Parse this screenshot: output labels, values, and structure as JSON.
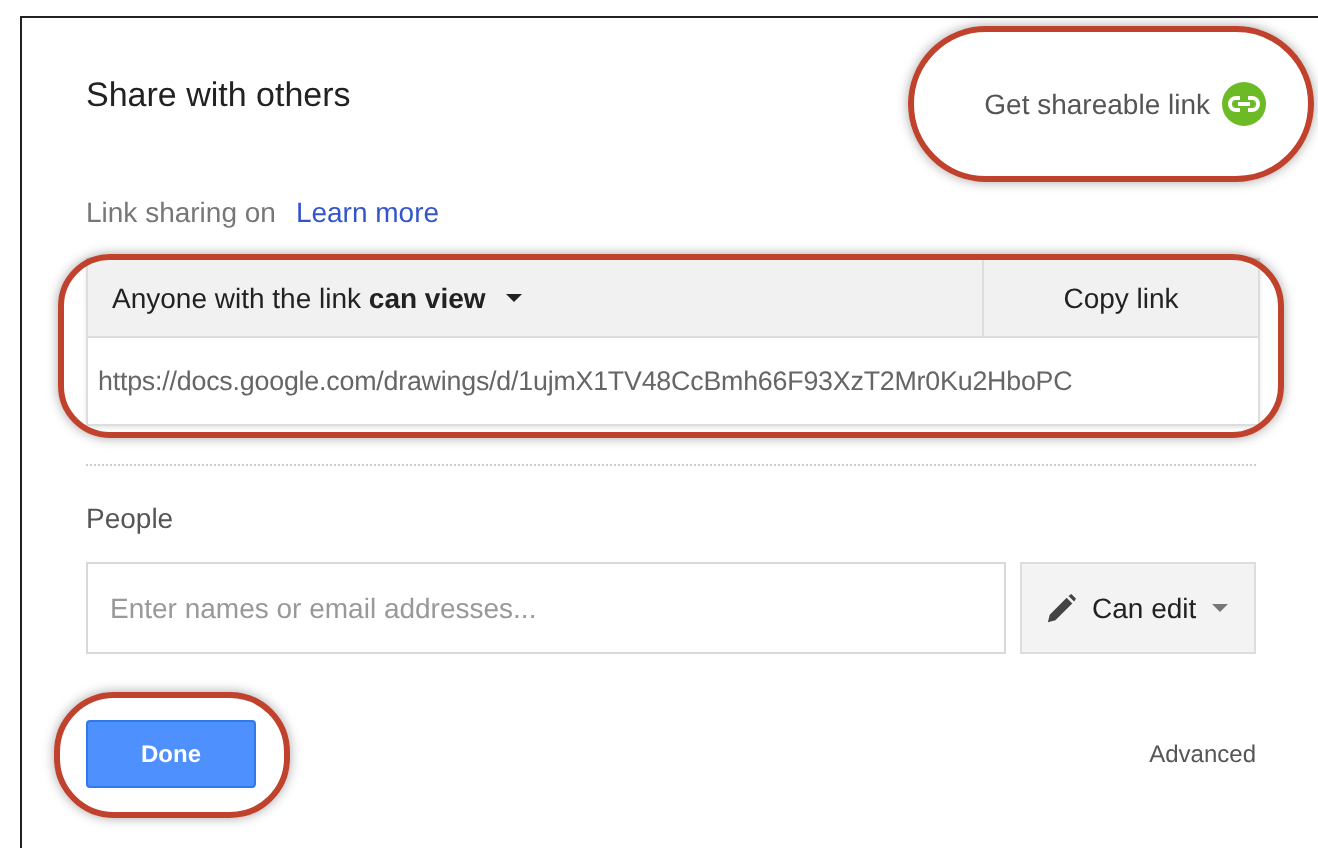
{
  "dialog": {
    "title": "Share with others"
  },
  "share_link": {
    "label": "Get shareable link",
    "highlighted": true
  },
  "link_sharing": {
    "status": "Link sharing on",
    "help_link": "Learn more"
  },
  "link_box": {
    "highlighted": true,
    "access": "Anyone with the link **can view**",
    "copy_button": "Copy link",
    "url": "https://docs.google.com/drawings/d/1ujmX1TV48CcBmh66F93XzT2Mr0Ku2HboPC"
  },
  "people": {
    "label": "People",
    "placeholder": "Enter names or email addresses...",
    "permission": "Can edit"
  },
  "footer": {
    "done": {
      "label": "Done",
      "highlighted": true
    },
    "advanced": "Advanced"
  }
}
